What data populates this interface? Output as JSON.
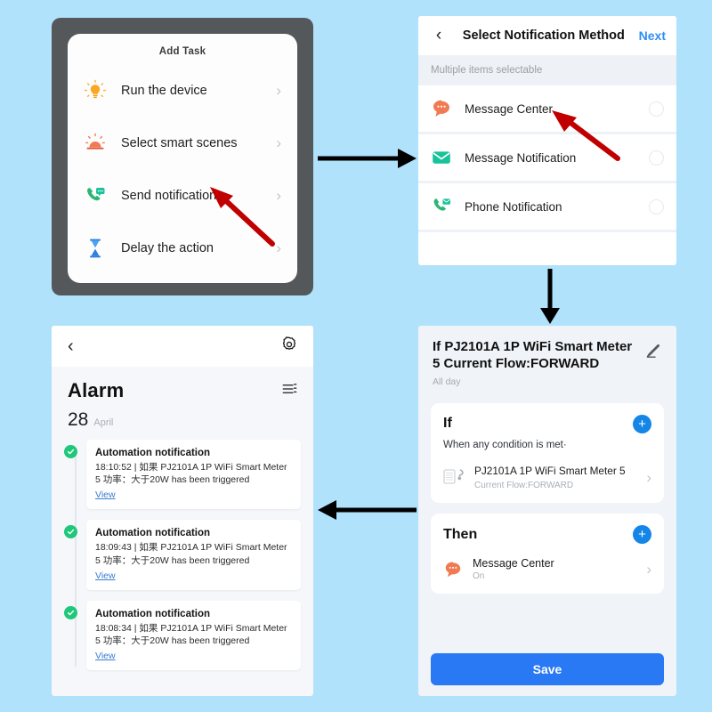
{
  "background_color": "#b0e2fb",
  "panel_add_task": {
    "title": "Add Task",
    "items": [
      {
        "label": "Run the device",
        "icon": "light-bulb-icon",
        "chevron": "›"
      },
      {
        "label": "Select smart scenes",
        "icon": "scene-sunrise-icon",
        "chevron": "›"
      },
      {
        "label": "Send notification",
        "icon": "phone-message-icon",
        "chevron": "›"
      },
      {
        "label": "Delay the action",
        "icon": "hourglass-icon",
        "chevron": "›"
      }
    ]
  },
  "panel_notification_method": {
    "back_label": "‹",
    "title": "Select Notification Method",
    "next_label": "Next",
    "subtitle": "Multiple items selectable",
    "items": [
      {
        "label": "Message Center",
        "icon": "speech-bubble-icon",
        "selected": false
      },
      {
        "label": "Message Notification",
        "icon": "envelope-icon",
        "selected": false
      },
      {
        "label": "Phone Notification",
        "icon": "phone-envelope-icon",
        "selected": false
      }
    ]
  },
  "panel_alarm": {
    "back_label": "‹",
    "gear_icon": "gear-icon",
    "filter_icon": "list-filter-icon",
    "heading": "Alarm",
    "date_day": "28",
    "date_month": "April",
    "entries": [
      {
        "title": "Automation notification",
        "body": "18:10:52 | 如果 PJ2101A 1P WiFi Smart Meter  5 功率：大于20W has been triggered",
        "link": "View"
      },
      {
        "title": "Automation notification",
        "body": "18:09:43 | 如果 PJ2101A 1P WiFi Smart Meter  5 功率：大于20W has been triggered",
        "link": "View"
      },
      {
        "title": "Automation notification",
        "body": "18:08:34 | 如果 PJ2101A 1P WiFi Smart Meter  5 功率：大于20W has been triggered",
        "link": "View"
      }
    ]
  },
  "panel_automation": {
    "title": "If PJ2101A 1P WiFi Smart Meter  5 Current Flow:FORWARD",
    "schedule": "All day",
    "edit_icon": "pencil-icon",
    "if_section": {
      "heading": "If",
      "add_label": "+",
      "condition_mode": "When any condition is met·",
      "device_name": "PJ2101A 1P WiFi Smart Meter 5",
      "device_state": "Current Flow:FORWARD",
      "chevron": "›"
    },
    "then_section": {
      "heading": "Then",
      "add_label": "+",
      "action_name": "Message Center",
      "action_state": "On",
      "chevron": "›"
    },
    "save_label": "Save"
  },
  "flow_arrows": [
    {
      "name": "arrow-add-task-to-notification-method",
      "direction": "right"
    },
    {
      "name": "arrow-notification-method-to-automation",
      "direction": "down"
    },
    {
      "name": "arrow-automation-to-alarm",
      "direction": "left"
    }
  ],
  "pointer_arrows": [
    {
      "name": "red-pointer-send-notification",
      "color": "#c00000"
    },
    {
      "name": "red-pointer-message-center",
      "color": "#c00000"
    }
  ]
}
